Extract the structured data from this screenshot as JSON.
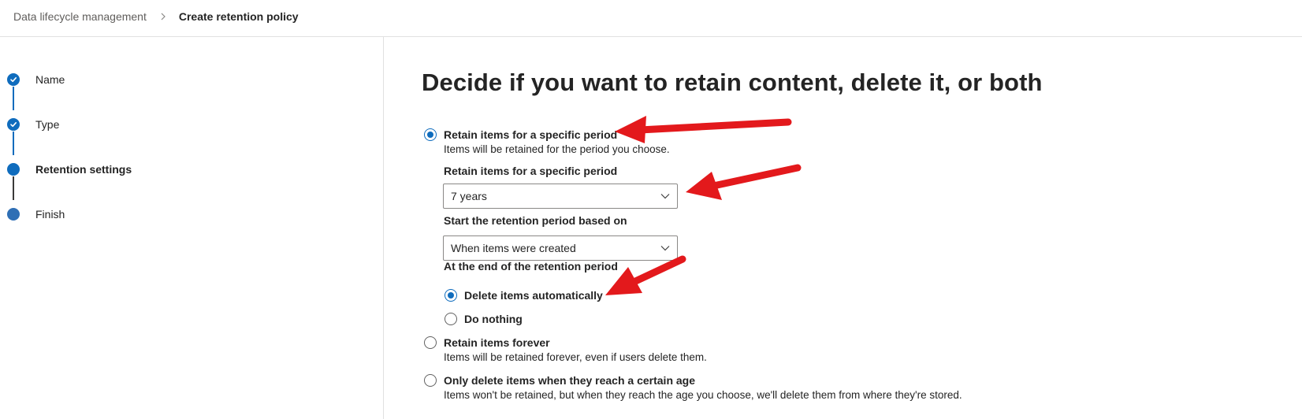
{
  "breadcrumb": {
    "parent": "Data lifecycle management",
    "current": "Create retention policy"
  },
  "stepper": {
    "steps": [
      {
        "label": "Name",
        "state": "completed"
      },
      {
        "label": "Type",
        "state": "completed"
      },
      {
        "label": "Retention settings",
        "state": "current"
      },
      {
        "label": "Finish",
        "state": "upcoming"
      }
    ]
  },
  "main": {
    "title": "Decide if you want to retain content, delete it, or both",
    "option_retain_period": {
      "label": "Retain items for a specific period",
      "description": "Items will be retained for the period you choose.",
      "checked": true
    },
    "retention_period": {
      "label": "Retain items for a specific period",
      "value": "7 years"
    },
    "start_based_on": {
      "label": "Start the retention period based on",
      "value": "When items were created"
    },
    "end_of_period": {
      "label": "At the end of the retention period",
      "delete_automatically": {
        "label": "Delete items automatically",
        "checked": true
      },
      "do_nothing": {
        "label": "Do nothing",
        "checked": false
      }
    },
    "option_retain_forever": {
      "label": "Retain items forever",
      "description": "Items will be retained forever, even if users delete them.",
      "checked": false
    },
    "option_delete_only": {
      "label": "Only delete items when they reach a certain age",
      "description": "Items won't be retained, but when they reach the age you choose, we'll delete them from where they're stored.",
      "checked": false
    }
  },
  "colors": {
    "accent": "#0f6cbd",
    "annotation_arrow": "#e3191c",
    "divider": "#e1e1e1"
  }
}
